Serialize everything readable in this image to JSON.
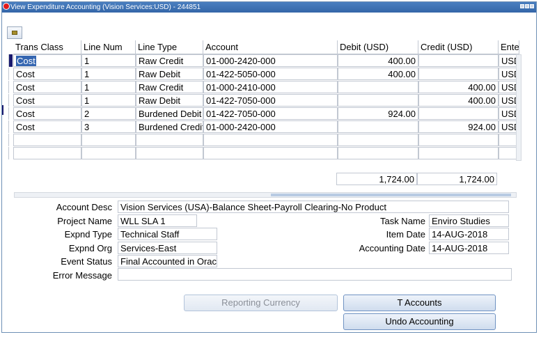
{
  "window": {
    "title": "View Expenditure Accounting (Vision Services:USD) - 244851"
  },
  "toolbar": {
    "icon": "folder-icon"
  },
  "table": {
    "columns": [
      "Trans Class",
      "Line Num",
      "Line Type",
      "Account",
      "Debit (USD)",
      "Credit (USD)",
      "Ente"
    ],
    "rows": [
      {
        "trans_class": "Cost",
        "line_num": "1",
        "line_type": "Raw Credit",
        "account": "01-000-2420-000",
        "debit": "400.00",
        "credit": "",
        "entered": "USD"
      },
      {
        "trans_class": "Cost",
        "line_num": "1",
        "line_type": "Raw Debit",
        "account": "01-422-5050-000",
        "debit": "400.00",
        "credit": "",
        "entered": "USD"
      },
      {
        "trans_class": "Cost",
        "line_num": "1",
        "line_type": "Raw Credit",
        "account": "01-000-2410-000",
        "debit": "",
        "credit": "400.00",
        "entered": "USD"
      },
      {
        "trans_class": "Cost",
        "line_num": "1",
        "line_type": "Raw Debit",
        "account": "01-422-7050-000",
        "debit": "",
        "credit": "400.00",
        "entered": "USD"
      },
      {
        "trans_class": "Cost",
        "line_num": "2",
        "line_type": "Burdened Debit",
        "account": "01-422-7050-000",
        "debit": "924.00",
        "credit": "",
        "entered": "USD"
      },
      {
        "trans_class": "Cost",
        "line_num": "3",
        "line_type": "Burdened Credit",
        "account": "01-000-2420-000",
        "debit": "",
        "credit": "924.00",
        "entered": "USD"
      },
      {
        "trans_class": "",
        "line_num": "",
        "line_type": "",
        "account": "",
        "debit": "",
        "credit": "",
        "entered": ""
      },
      {
        "trans_class": "",
        "line_num": "",
        "line_type": "",
        "account": "",
        "debit": "",
        "credit": "",
        "entered": ""
      }
    ],
    "totals": {
      "debit": "1,724.00",
      "credit": "1,724.00"
    }
  },
  "details": {
    "account_desc_label": "Account Desc",
    "account_desc": "Vision Services (USA)-Balance Sheet-Payroll Clearing-No Product",
    "project_name_label": "Project Name",
    "project_name": "WLL SLA 1",
    "task_name_label": "Task Name",
    "task_name": "Enviro Studies",
    "expnd_type_label": "Expnd Type",
    "expnd_type": "Technical Staff",
    "item_date_label": "Item Date",
    "item_date": "14-AUG-2018",
    "expnd_org_label": "Expnd Org",
    "expnd_org": "Services-East",
    "accounting_date_label": "Accounting Date",
    "accounting_date": "14-AUG-2018",
    "event_status_label": "Event Status",
    "event_status": "Final Accounted in Oracle",
    "error_message_label": "Error Message",
    "error_message": ""
  },
  "buttons": {
    "reporting_currency": "Reporting Currency",
    "t_accounts": "T Accounts",
    "undo_accounting": "Undo Accounting"
  }
}
